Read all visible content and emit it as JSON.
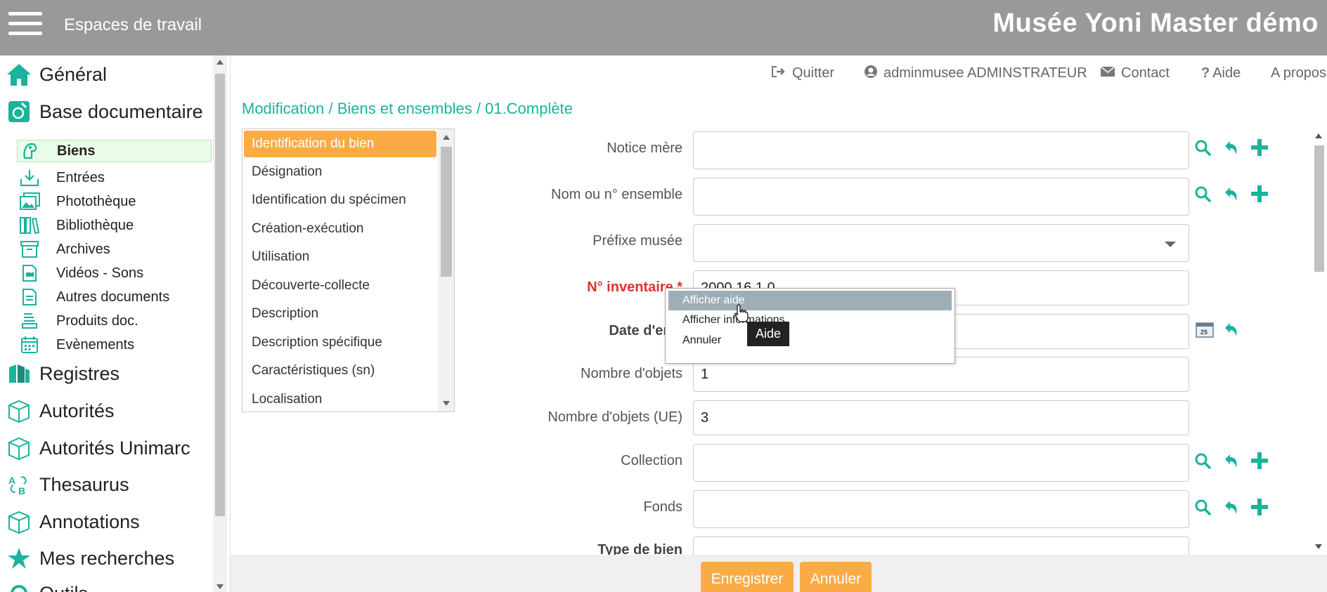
{
  "header": {
    "workspaces_label": "Espaces de travail",
    "app_title": "Musée Yoni Master démo"
  },
  "sidebar": {
    "main_items": [
      {
        "label": "Général",
        "icon": "home-icon"
      },
      {
        "label": "Base documentaire",
        "icon": "document-base-icon"
      },
      {
        "label": "Registres",
        "icon": "registers-icon"
      },
      {
        "label": "Autorités",
        "icon": "box-icon"
      },
      {
        "label": "Autorités Unimarc",
        "icon": "box-icon"
      },
      {
        "label": "Thesaurus",
        "icon": "thesaurus-icon"
      },
      {
        "label": "Annotations",
        "icon": "box-icon"
      },
      {
        "label": "Mes recherches",
        "icon": "star-icon"
      },
      {
        "label": "Outils",
        "icon": "tools-icon"
      }
    ],
    "sub_items": [
      {
        "label": "Biens",
        "icon": "goods-icon",
        "active": true
      },
      {
        "label": "Entrées",
        "icon": "inbox-icon"
      },
      {
        "label": "Photothèque",
        "icon": "photo-library-icon"
      },
      {
        "label": "Bibliothèque",
        "icon": "library-icon"
      },
      {
        "label": "Archives",
        "icon": "archive-icon"
      },
      {
        "label": "Vidéos - Sons",
        "icon": "video-icon"
      },
      {
        "label": "Autres documents",
        "icon": "file-icon"
      },
      {
        "label": "Produits doc.",
        "icon": "stack-icon"
      },
      {
        "label": "Evènements",
        "icon": "calendar-icon"
      }
    ]
  },
  "topmenu": {
    "quit": "Quitter",
    "user": "adminmusee ADMINSTRATEUR",
    "contact": "Contact",
    "help": "Aide",
    "about": "A propos"
  },
  "breadcrumb": "Modification / Biens et ensembles / 01.Complète",
  "sections": [
    "Identification du bien",
    "Désignation",
    "Identification du spécimen",
    "Création-exécution",
    "Utilisation",
    "Découverte-collecte",
    "Description",
    "Description spécifique",
    "Caractéristiques (sn)",
    "Localisation"
  ],
  "form": {
    "notice_mere": {
      "label": "Notice mère",
      "value": ""
    },
    "nom_ensemble": {
      "label": "Nom ou n° ensemble",
      "value": ""
    },
    "prefixe": {
      "label": "Préfixe musée",
      "value": ""
    },
    "inventaire": {
      "label": "N° inventaire *",
      "value": "2000.16.1.0"
    },
    "date_entree": {
      "label": "Date d'entr",
      "value": ""
    },
    "nb_objets": {
      "label": "Nombre d'objets",
      "value": "1"
    },
    "nb_objets_ue": {
      "label": "Nombre d'objets (UE)",
      "value": "3"
    },
    "collection": {
      "label": "Collection",
      "value": ""
    },
    "fonds": {
      "label": "Fonds",
      "value": ""
    },
    "type_bien": {
      "label": "Type de bien",
      "value": ""
    }
  },
  "context_menu": {
    "items": [
      "Afficher aide",
      "Afficher informations",
      "Annuler"
    ],
    "tooltip": "Aide"
  },
  "buttons": {
    "save": "Enregistrer",
    "cancel": "Annuler"
  },
  "colors": {
    "accent_teal": "#1ab39b",
    "accent_orange": "#fbab46",
    "topbar_gray": "#999999",
    "required_red": "#e03030"
  }
}
